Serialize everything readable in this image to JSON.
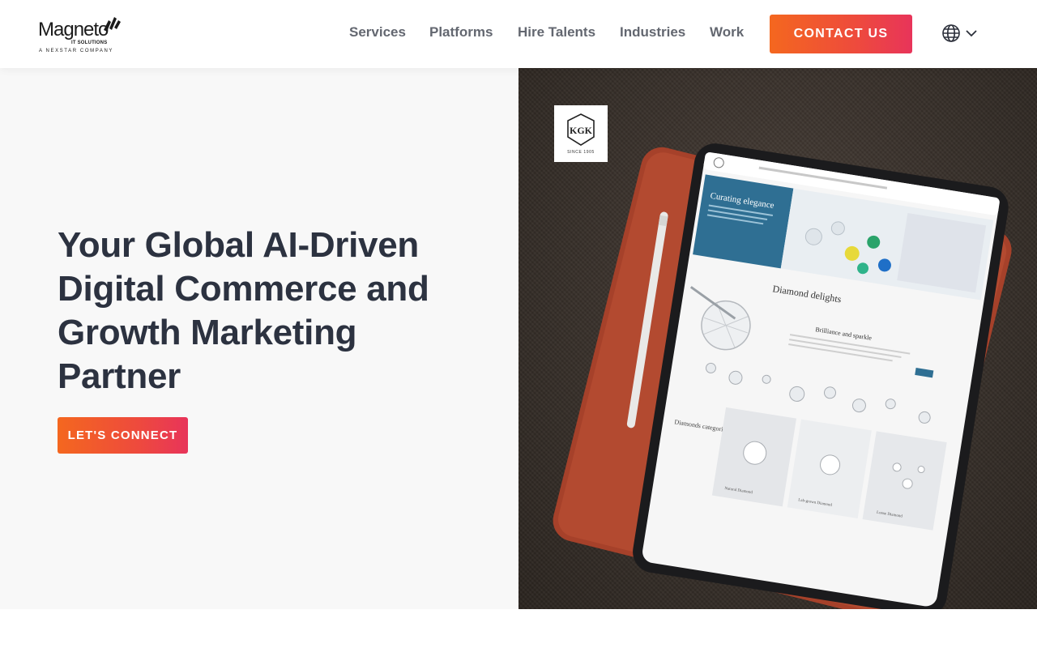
{
  "header": {
    "logo": {
      "brand": "Magneto",
      "sub": "IT SOLUTIONS",
      "tagline": "A NEXSTAR COMPANY"
    },
    "nav": [
      {
        "label": "Services"
      },
      {
        "label": "Platforms"
      },
      {
        "label": "Hire Talents"
      },
      {
        "label": "Industries"
      },
      {
        "label": "Work"
      }
    ],
    "contact_label": "CONTACT US",
    "language_icon": "globe-icon",
    "language_chevron": "chevron-down-icon"
  },
  "hero": {
    "title": "Your Global AI-Driven Digital Commerce and Growth Marketing Partner",
    "cta_label": "LET'S CONNECT",
    "image": {
      "badge_logo": "KGK",
      "badge_since": "SINCE 1905",
      "tablet_heading": "Curating elegance",
      "tablet_subheading": "Diamond delights",
      "tablet_section": "Brilliance and sparkle",
      "tablet_categories": "Diamonds categories",
      "tablet_cards": [
        "Natural Diamond",
        "Lab-grown Diamond",
        "Loose Diamond"
      ]
    }
  },
  "colors": {
    "accent_start": "#f4671f",
    "accent_end": "#e8345a",
    "heading": "#2c3240",
    "nav_text": "#636770",
    "hero_bg": "#f8f8f8"
  }
}
